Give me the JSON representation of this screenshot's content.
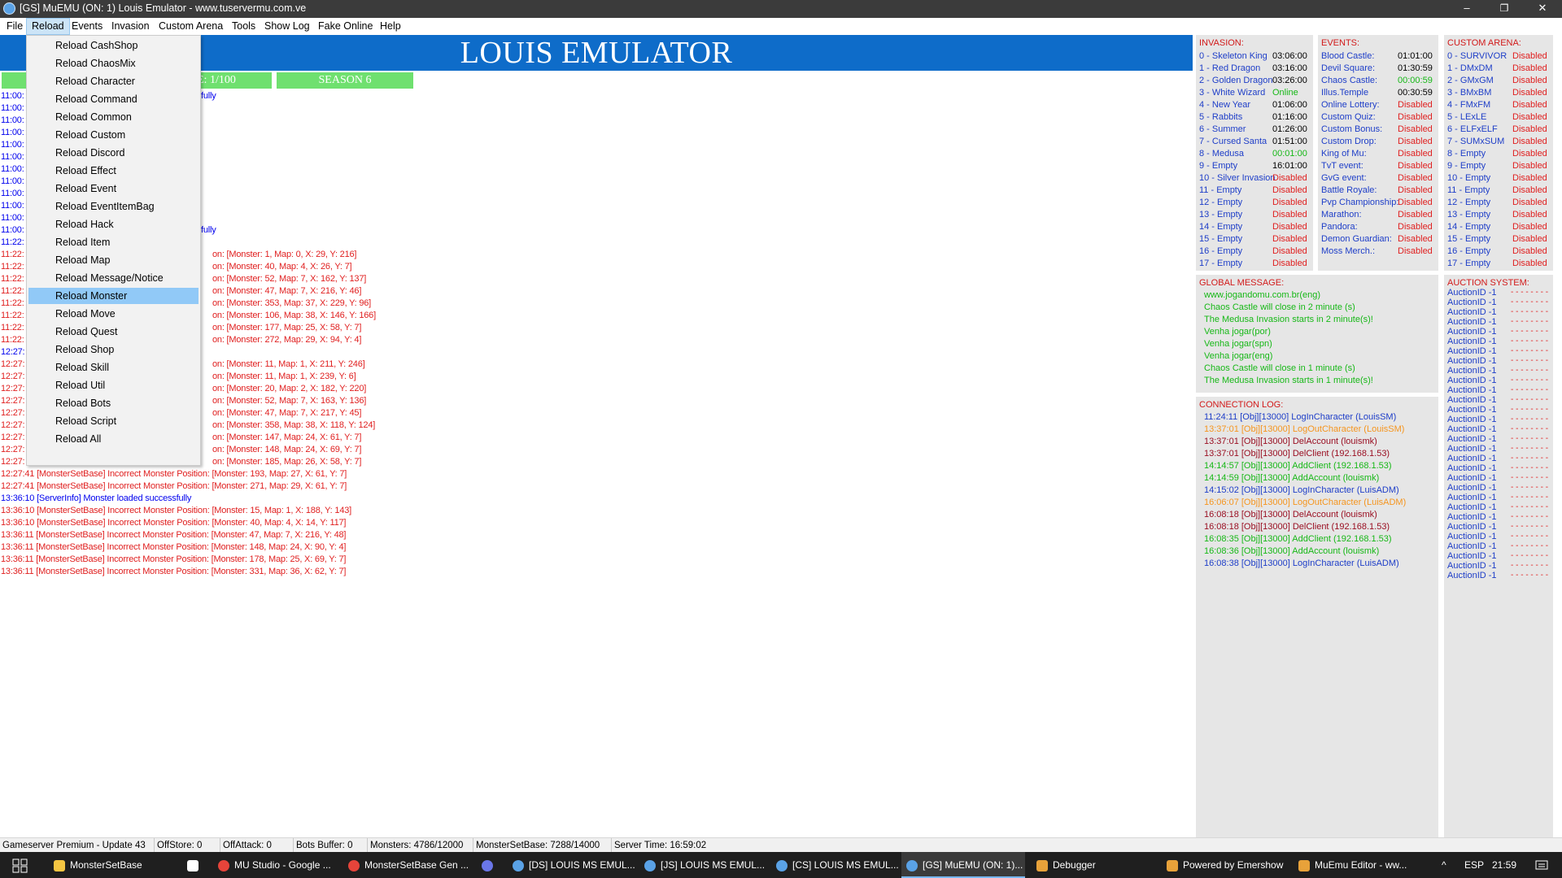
{
  "window": {
    "title": "[GS] MuEMU (ON: 1) Louis Emulator - www.tuservermu.com.ve",
    "minimize": "–",
    "maximize": "❐",
    "close": "✕"
  },
  "menu": [
    "File",
    "Reload",
    "Events",
    "Invasion",
    "Custom Arena",
    "Tools",
    "Show Log",
    "Fake Online",
    "Help"
  ],
  "header": {
    "title": "LOUIS EMULATOR",
    "bar2": "E: 1/100",
    "bar3": "SEASON 6"
  },
  "dropdown": [
    "Reload CashShop",
    "Reload ChaosMix",
    "Reload Character",
    "Reload Command",
    "Reload Common",
    "Reload Custom",
    "Reload Discord",
    "Reload Effect",
    "Reload Event",
    "Reload EventItemBag",
    "Reload Hack",
    "Reload Item",
    "Reload Map",
    "Reload Message/Notice",
    "Reload Monster",
    "Reload Move",
    "Reload Quest",
    "Reload Shop",
    "Reload Skill",
    "Reload Util",
    "Reload Bots",
    "Reload Script",
    "Reload All"
  ],
  "log_partial": [
    {
      "t": "11:00:",
      "r": "fully",
      "c": "blue"
    },
    {
      "t": "11:00:",
      "r": "",
      "c": "blue"
    },
    {
      "t": "11:00:",
      "r": "",
      "c": "blue"
    },
    {
      "t": "11:00:",
      "r": "",
      "c": "blue"
    },
    {
      "t": "11:00:",
      "r": "",
      "c": "blue"
    },
    {
      "t": "11:00:",
      "r": "",
      "c": "blue"
    },
    {
      "t": "11:00:",
      "r": "",
      "c": "blue"
    },
    {
      "t": "11:00:",
      "r": "",
      "c": "blue"
    },
    {
      "t": "11:00:",
      "r": "",
      "c": "blue"
    },
    {
      "t": "11:00:",
      "r": "",
      "c": "blue"
    },
    {
      "t": "11:00:",
      "r": "",
      "c": "blue"
    },
    {
      "t": "11:00:",
      "r": "fully",
      "c": "blue"
    },
    {
      "t": "11:22:",
      "r": "",
      "c": "blue"
    },
    {
      "t": "11:22:",
      "r": "on: [Monster: 1, Map: 0, X: 29, Y: 216]",
      "c": "red"
    },
    {
      "t": "11:22:",
      "r": "on: [Monster: 40, Map: 4, X: 26, Y: 7]",
      "c": "red"
    },
    {
      "t": "11:22:",
      "r": "on: [Monster: 52, Map: 7, X: 162, Y: 137]",
      "c": "red"
    },
    {
      "t": "11:22:",
      "r": "on: [Monster: 47, Map: 7, X: 216, Y: 46]",
      "c": "red"
    },
    {
      "t": "11:22:",
      "r": "on: [Monster: 353, Map: 37, X: 229, Y: 96]",
      "c": "red"
    },
    {
      "t": "11:22:",
      "r": "on: [Monster: 106, Map: 38, X: 146, Y: 166]",
      "c": "red"
    },
    {
      "t": "11:22:",
      "r": "on: [Monster: 177, Map: 25, X: 58, Y: 7]",
      "c": "red"
    },
    {
      "t": "11:22:",
      "r": "on: [Monster: 272, Map: 29, X: 94, Y: 4]",
      "c": "red"
    },
    {
      "t": "12:27:",
      "r": "",
      "c": "blue"
    },
    {
      "t": "12:27:",
      "r": "on: [Monster: 11, Map: 1, X: 211, Y: 246]",
      "c": "red"
    },
    {
      "t": "12:27:",
      "r": "on: [Monster: 11, Map: 1, X: 239, Y: 6]",
      "c": "red"
    },
    {
      "t": "12:27:",
      "r": "on: [Monster: 20, Map: 2, X: 182, Y: 220]",
      "c": "red"
    },
    {
      "t": "12:27:",
      "r": "on: [Monster: 52, Map: 7, X: 163, Y: 136]",
      "c": "red"
    },
    {
      "t": "12:27:",
      "r": "on: [Monster: 47, Map: 7, X: 217, Y: 45]",
      "c": "red"
    },
    {
      "t": "12:27:",
      "r": "on: [Monster: 358, Map: 38, X: 118, Y: 124]",
      "c": "red"
    },
    {
      "t": "12:27:",
      "r": "on: [Monster: 147, Map: 24, X: 61, Y: 7]",
      "c": "red"
    },
    {
      "t": "12:27:",
      "r": "on: [Monster: 148, Map: 24, X: 69, Y: 7]",
      "c": "red"
    },
    {
      "t": "12:27:",
      "r": "on: [Monster: 185, Map: 26, X: 58, Y: 7]",
      "c": "red"
    }
  ],
  "log_full": [
    {
      "text": "12:27:41 [MonsterSetBase] Incorrect Monster Position: [Monster: 193, Map: 27, X: 61, Y: 7]",
      "c": "red"
    },
    {
      "text": "12:27:41 [MonsterSetBase] Incorrect Monster Position: [Monster: 271, Map: 29, X: 61, Y: 7]",
      "c": "red"
    },
    {
      "text": "13:36:10 [ServerInfo] Monster loaded successfully",
      "c": "blue"
    },
    {
      "text": "13:36:10 [MonsterSetBase] Incorrect Monster Position: [Monster: 15, Map: 1, X: 188, Y: 143]",
      "c": "red"
    },
    {
      "text": "13:36:10 [MonsterSetBase] Incorrect Monster Position: [Monster: 40, Map: 4, X: 14, Y: 117]",
      "c": "red"
    },
    {
      "text": "13:36:11 [MonsterSetBase] Incorrect Monster Position: [Monster: 47, Map: 7, X: 216, Y: 48]",
      "c": "red"
    },
    {
      "text": "13:36:11 [MonsterSetBase] Incorrect Monster Position: [Monster: 148, Map: 24, X: 90, Y: 4]",
      "c": "red"
    },
    {
      "text": "13:36:11 [MonsterSetBase] Incorrect Monster Position: [Monster: 178, Map: 25, X: 69, Y: 7]",
      "c": "red"
    },
    {
      "text": "13:36:11 [MonsterSetBase] Incorrect Monster Position: [Monster: 331, Map: 36, X: 62, Y: 7]",
      "c": "red"
    }
  ],
  "invasion": {
    "title": "INVASION:",
    "rows": [
      {
        "n": "0 - Skeleton King",
        "v": "03:06:00",
        "c": "blk"
      },
      {
        "n": "1 - Red Dragon",
        "v": "03:16:00",
        "c": "blk"
      },
      {
        "n": "2 - Golden Dragon",
        "v": "03:26:00",
        "c": "blk"
      },
      {
        "n": "3 - White Wizard",
        "v": "Online",
        "c": "grn"
      },
      {
        "n": "4 - New Year",
        "v": "01:06:00",
        "c": "blk"
      },
      {
        "n": "5 - Rabbits",
        "v": "01:16:00",
        "c": "blk"
      },
      {
        "n": "6 - Summer",
        "v": "01:26:00",
        "c": "blk"
      },
      {
        "n": "7 - Cursed Santa",
        "v": "01:51:00",
        "c": "blk"
      },
      {
        "n": "8 - Medusa",
        "v": "00:01:00",
        "c": "grn"
      },
      {
        "n": "9 - Empty",
        "v": "16:01:00",
        "c": "blk"
      },
      {
        "n": "10 - Silver Invasion",
        "v": "Disabled",
        "c": "dis"
      },
      {
        "n": "11 - Empty",
        "v": "Disabled",
        "c": "dis"
      },
      {
        "n": "12 - Empty",
        "v": "Disabled",
        "c": "dis"
      },
      {
        "n": "13 - Empty",
        "v": "Disabled",
        "c": "dis"
      },
      {
        "n": "14 - Empty",
        "v": "Disabled",
        "c": "dis"
      },
      {
        "n": "15 - Empty",
        "v": "Disabled",
        "c": "dis"
      },
      {
        "n": "16 - Empty",
        "v": "Disabled",
        "c": "dis"
      },
      {
        "n": "17 - Empty",
        "v": "Disabled",
        "c": "dis"
      }
    ]
  },
  "events": {
    "title": "EVENTS:",
    "rows": [
      {
        "n": "Blood Castle:",
        "v": "01:01:00",
        "c": "blk"
      },
      {
        "n": "Devil Square:",
        "v": "01:30:59",
        "c": "blk"
      },
      {
        "n": "Chaos Castle:",
        "v": "00:00:59",
        "c": "grn"
      },
      {
        "n": "Illus.Temple",
        "v": "00:30:59",
        "c": "blk"
      },
      {
        "n": "Online Lottery:",
        "v": "Disabled",
        "c": "dis"
      },
      {
        "n": "Custom Quiz:",
        "v": "Disabled",
        "c": "dis"
      },
      {
        "n": "Custom Bonus:",
        "v": "Disabled",
        "c": "dis"
      },
      {
        "n": "Custom Drop:",
        "v": "Disabled",
        "c": "dis"
      },
      {
        "n": "King of Mu:",
        "v": "Disabled",
        "c": "dis"
      },
      {
        "n": "TvT event:",
        "v": "Disabled",
        "c": "dis"
      },
      {
        "n": "GvG event:",
        "v": "Disabled",
        "c": "dis"
      },
      {
        "n": "Battle Royale:",
        "v": "Disabled",
        "c": "dis"
      },
      {
        "n": "Pvp Championship:",
        "v": "Disabled",
        "c": "dis"
      },
      {
        "n": "Marathon:",
        "v": "Disabled",
        "c": "dis"
      },
      {
        "n": "Pandora:",
        "v": "Disabled",
        "c": "dis"
      },
      {
        "n": "Demon Guardian:",
        "v": "Disabled",
        "c": "dis"
      },
      {
        "n": "Moss Merch.:",
        "v": "Disabled",
        "c": "dis"
      }
    ]
  },
  "arena": {
    "title": "CUSTOM ARENA:",
    "rows": [
      {
        "n": "0 - SURVIVOR",
        "v": "Disabled"
      },
      {
        "n": "1 - DMxDM",
        "v": "Disabled"
      },
      {
        "n": "2 - GMxGM",
        "v": "Disabled"
      },
      {
        "n": "3 - BMxBM",
        "v": "Disabled"
      },
      {
        "n": "4 - FMxFM",
        "v": "Disabled"
      },
      {
        "n": "5 - LExLE",
        "v": "Disabled"
      },
      {
        "n": "6 - ELFxELF",
        "v": "Disabled"
      },
      {
        "n": "7 - SUMxSUM",
        "v": "Disabled"
      },
      {
        "n": "8 - Empty",
        "v": "Disabled"
      },
      {
        "n": "9 - Empty",
        "v": "Disabled"
      },
      {
        "n": "10 - Empty",
        "v": "Disabled"
      },
      {
        "n": "11 - Empty",
        "v": "Disabled"
      },
      {
        "n": "12 - Empty",
        "v": "Disabled"
      },
      {
        "n": "13 - Empty",
        "v": "Disabled"
      },
      {
        "n": "14 - Empty",
        "v": "Disabled"
      },
      {
        "n": "15 - Empty",
        "v": "Disabled"
      },
      {
        "n": "16 - Empty",
        "v": "Disabled"
      },
      {
        "n": "17 - Empty",
        "v": "Disabled"
      }
    ]
  },
  "global_message": {
    "title": "GLOBAL MESSAGE:",
    "lines": [
      "www.jogandomu.com.br(eng)",
      "Chaos Castle will close in 2 minute (s)",
      "The Medusa Invasion starts in 2 minute(s)!",
      "Venha jogar(por)",
      "Venha jogar(spn)",
      "Venha jogar(eng)",
      "Chaos Castle will close in 1 minute (s)",
      "The Medusa Invasion starts in 1 minute(s)!"
    ]
  },
  "connection_log": {
    "title": "CONNECTION LOG:",
    "lines": [
      {
        "t": "11:24:11 [Obj][13000] LogInCharacter (LouisSM)",
        "c": "lc"
      },
      {
        "t": "13:37:01 [Obj][13000] LogOutCharacter (LouisSM)",
        "c": "orange"
      },
      {
        "t": "13:37:01 [Obj][13000] DelAccount (louismk)",
        "c": "maroon"
      },
      {
        "t": "13:37:01 [Obj][13000] DelClient (192.168.1.53)",
        "c": "maroon"
      },
      {
        "t": "14:14:57 [Obj][13000] AddClient (192.168.1.53)",
        "c": "grn"
      },
      {
        "t": "14:14:59 [Obj][13000] AddAccount (louismk)",
        "c": "grn"
      },
      {
        "t": "14:15:02 [Obj][13000] LogInCharacter (LuisADM)",
        "c": "lc"
      },
      {
        "t": "16:06:07 [Obj][13000] LogOutCharacter (LuisADM)",
        "c": "orange"
      },
      {
        "t": "16:08:18 [Obj][13000] DelAccount (louismk)",
        "c": "maroon"
      },
      {
        "t": "16:08:18 [Obj][13000] DelClient (192.168.1.53)",
        "c": "maroon"
      },
      {
        "t": "16:08:35 [Obj][13000] AddClient (192.168.1.53)",
        "c": "grn"
      },
      {
        "t": "16:08:36 [Obj][13000] AddAccount (louismk)",
        "c": "grn"
      },
      {
        "t": "16:08:38 [Obj][13000] LogInCharacter (LuisADM)",
        "c": "lc"
      }
    ]
  },
  "auction": {
    "title": "AUCTION SYSTEM:",
    "label": "AuctionID -1",
    "dashes": "- - - - - - - -",
    "count": 30
  },
  "statusbar": [
    "Gameserver Premium - Update 43",
    "OffStore: 0",
    "OffAttack: 0",
    "Bots Buffer: 0",
    "Monsters: 4786/12000",
    "MonsterSetBase: 7288/14000",
    "Server Time: 16:59:02"
  ],
  "taskbar": {
    "items": [
      "MonsterSetBase",
      "",
      "MU Studio - Google ...",
      "MonsterSetBase Gen ...",
      "",
      "[DS] LOUIS MS EMUL...",
      "[JS] LOUIS MS EMUL...",
      "[CS] LOUIS MS EMUL...",
      "[GS] MuEMU (ON: 1)...",
      "Debugger",
      "Powered by Emershow",
      "MuEmu Editor - ww..."
    ],
    "lang": "ESP",
    "time": "21:59",
    "up_arrow": "^"
  },
  "colors": {
    "header_blue": "#0e6cc9",
    "green_bar": "#6fe06f",
    "panel_bg": "#e6e6e6",
    "title_red": "#d21a1a"
  }
}
